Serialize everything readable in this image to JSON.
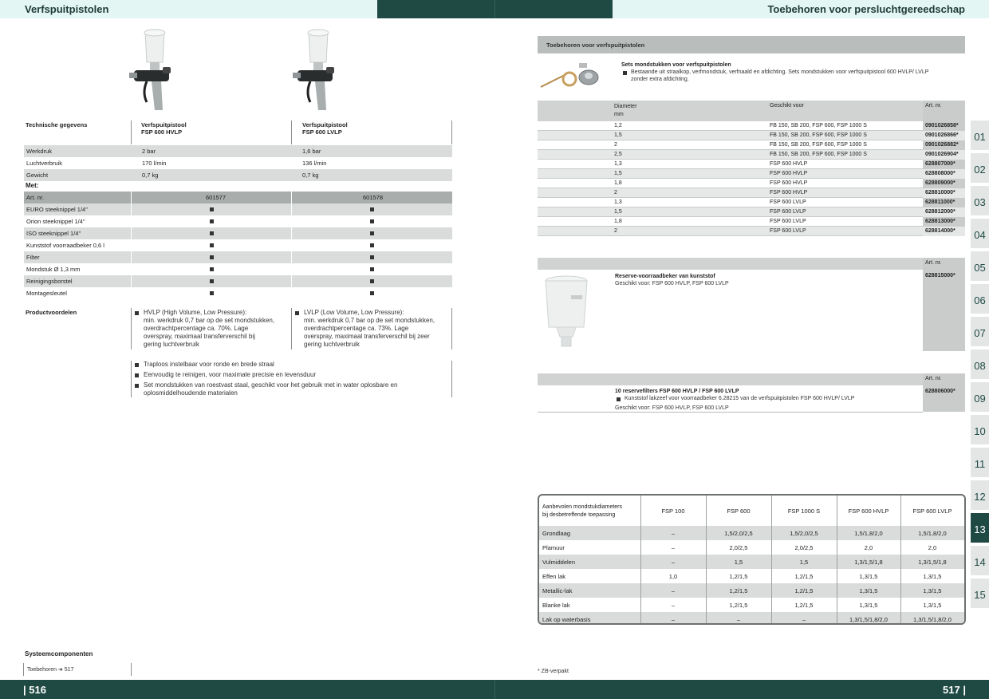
{
  "header": {
    "left_title": "Verfspuitpistolen",
    "right_title": "Toebehoren voor persluchtgereedschap"
  },
  "footer": {
    "left_page": "| 516",
    "right_page": "517 |"
  },
  "left": {
    "products": [
      {
        "name_line1": "Verfspuitpistool",
        "name_line2": "FSP 600 HVLP"
      },
      {
        "name_line1": "Verfspuitpistool",
        "name_line2": "FSP 600 LVLP"
      }
    ],
    "tech_label": "Technische gegevens",
    "tech_rows": [
      {
        "label": "Werkdruk",
        "v1": "2 bar",
        "v2": "1,6 bar"
      },
      {
        "label": "Luchtverbruik",
        "v1": "170 l/min",
        "v2": "136 l/min"
      },
      {
        "label": "Gewicht",
        "v1": "0,7 kg",
        "v2": "0,7 kg"
      }
    ],
    "met_label": "Met:",
    "art_label": "Art. nr.",
    "art_v1": "601577",
    "art_v2": "601578",
    "met_rows": [
      "EURO steeknippel 1/4\"",
      "Orion steeknippel 1/4\"",
      "ISO steeknippel 1/4\"",
      "Kunststof voorraadbeker 0,6 l",
      "Filter",
      "Mondstuk Ø 1,3 mm",
      "Reinigingsborstel",
      "Montagesleutel"
    ],
    "adv_label": "Productvoordelen",
    "adv_hvlp": [
      "HVLP (High Volume, Low Pressure):",
      "min. werkdruk 0,7 bar op de set mondstukken,",
      "overdrachtpercentage ca. 70%. Lage",
      "overspray, maximaal transferverschil bij",
      "gering luchtverbruik"
    ],
    "adv_lvlp": [
      "LVLP (Low Volume, Low Pressure):",
      "min. werkdruk 0,7 bar op de set mondstukken,",
      "overdrachtpercentage ca. 73%. Lage",
      "overspray, maximaal transferverschil bij zeer",
      "gering luchtverbruik"
    ],
    "adv_general": [
      "Traploos instelbaar voor ronde en brede straal",
      "Eenvoudig te reinigen, voor maximale precisie en levensduur",
      "Set mondstukken van roestvast staal, geschikt voor het gebruik met in water oplosbare en",
      "oplosmiddelhoudende materialen"
    ],
    "sys_label": "Systeemcomponenten",
    "sys_link": "Toebehoren ➜ 517"
  },
  "right": {
    "section_title": "Toebehoren voor verfspuitpistolen",
    "nozzle": {
      "title": "Sets mondstukken voor verfspuitpistolen",
      "desc1": "Bestaande uit straalkop, verfmondstuk, verfnaald en afdichting. Sets mondstukken voor verfspuitpistool 600 HVLP/ LVLP",
      "desc2": "zonder extra afdichting."
    },
    "nozzle_headers": {
      "diam1": "Diameter",
      "diam2": "mm",
      "suitable": "Geschikt voor",
      "art": "Art. nr."
    },
    "nozzle_rows": [
      {
        "d": "1,2",
        "s": "FB 150, SB 200, FSP 600, FSP 1000 S",
        "a": "0901026858*"
      },
      {
        "d": "1,5",
        "s": "FB 150, SB 200, FSP 600, FSP 1000 S",
        "a": "0901026866*"
      },
      {
        "d": "2",
        "s": "FB 150, SB 200, FSP 600, FSP 1000 S",
        "a": "0901026882*"
      },
      {
        "d": "2,5",
        "s": "FB 150, SB 200, FSP 600, FSP 1000 S",
        "a": "0901026904*"
      },
      {
        "d": "1,3",
        "s": "FSP 600 HVLP",
        "a": "628807000*"
      },
      {
        "d": "1,5",
        "s": "FSP 600 HVLP",
        "a": "628808000*"
      },
      {
        "d": "1,8",
        "s": "FSP 600 HVLP",
        "a": "628809000*"
      },
      {
        "d": "2",
        "s": "FSP 600 HVLP",
        "a": "628810000*"
      },
      {
        "d": "1,3",
        "s": "FSP 600 LVLP",
        "a": "628811000*"
      },
      {
        "d": "1,5",
        "s": "FSP 600 LVLP",
        "a": "628812000*"
      },
      {
        "d": "1,8",
        "s": "FSP 600 LVLP",
        "a": "628813000*"
      },
      {
        "d": "2",
        "s": "FSP 600 LVLP",
        "a": "628814000*"
      }
    ],
    "cup": {
      "art_label": "Art. nr.",
      "title": "Reserve-voorraadbeker van kunststof",
      "desc": "Geschikt voor: FSP 600 HVLP, FSP 600 LVLP",
      "art": "628815000*"
    },
    "filters": {
      "art_label": "Art. nr.",
      "title": "10 reservefilters FSP 600 HVLP / FSP 600 LVLP",
      "desc1": "Kunststof lakzeef voor voorraadbeker 6.28215 van de verfspuitpistolen FSP 600 HVLP/ LVLP",
      "desc2": "Geschikt voor: FSP 600 HVLP, FSP 600 LVLP",
      "art": "628806000*"
    },
    "rec": {
      "head1": "Aanbevolen mondstukdiameters",
      "head2": "bij desbetreffende toepassing",
      "cols": [
        "FSP 100",
        "FSP 600",
        "FSP 1000 S",
        "FSP 600 HVLP",
        "FSP 600 LVLP"
      ],
      "rows": [
        {
          "label": "Grondlaag",
          "vals": [
            "–",
            "1,5/2,0/2,5",
            "1,5/2,0/2,5",
            "1,5/1,8/2,0",
            "1,5/1,8/2,0"
          ]
        },
        {
          "label": "Plamuur",
          "vals": [
            "–",
            "2,0/2,5",
            "2,0/2,5",
            "2,0",
            "2,0"
          ]
        },
        {
          "label": "Vulmiddelen",
          "vals": [
            "–",
            "1,5",
            "1,5",
            "1,3/1,5/1,8",
            "1,3/1,5/1,8"
          ]
        },
        {
          "label": "Effen lak",
          "vals": [
            "1,0",
            "1,2/1,5",
            "1,2/1,5",
            "1,3/1,5",
            "1,3/1,5"
          ]
        },
        {
          "label": "Metallic-lak",
          "vals": [
            "–",
            "1,2/1,5",
            "1,2/1,5",
            "1,3/1,5",
            "1,3/1,5"
          ]
        },
        {
          "label": "Blanke lak",
          "vals": [
            "–",
            "1,2/1,5",
            "1,2/1,5",
            "1,3/1,5",
            "1,3/1,5"
          ]
        },
        {
          "label": "Lak op waterbasis",
          "vals": [
            "–",
            "–",
            "–",
            "1,3/1,5/1,8/2,0",
            "1,3/1,5/1,8/2,0"
          ]
        }
      ]
    },
    "footnote": "* ZB-verpakt"
  },
  "tabs": [
    "01",
    "02",
    "03",
    "04",
    "05",
    "06",
    "07",
    "08",
    "09",
    "10",
    "11",
    "12",
    "13",
    "14",
    "15"
  ],
  "active_tab": "13",
  "colors": {
    "brand_dark": "#1f4a44",
    "header_light": "#e4f6f3",
    "row_shade": "#d9dcdb"
  }
}
